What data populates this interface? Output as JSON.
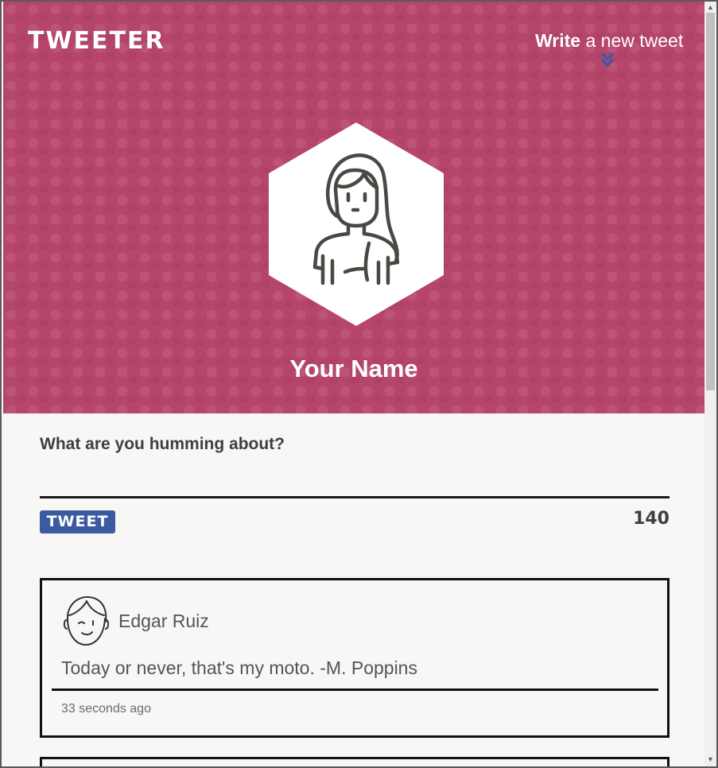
{
  "header": {
    "brand": "TWEETER",
    "write_link_strong": "Write",
    "write_link_rest": "a new tweet",
    "accent_color": "#b6456b"
  },
  "profile": {
    "name": "Your Name",
    "avatar_icon": "girl-avatar-icon"
  },
  "composer": {
    "label": "What are you humming about?",
    "input_value": "",
    "button_label": "TWEET",
    "char_count": "140",
    "button_color": "#3b5aa0"
  },
  "tweets": [
    {
      "author": "Edgar Ruiz",
      "avatar_icon": "boy-avatar-icon",
      "text": "Today or never, that's my moto. -M. Poppins",
      "time": "33 seconds ago"
    }
  ]
}
